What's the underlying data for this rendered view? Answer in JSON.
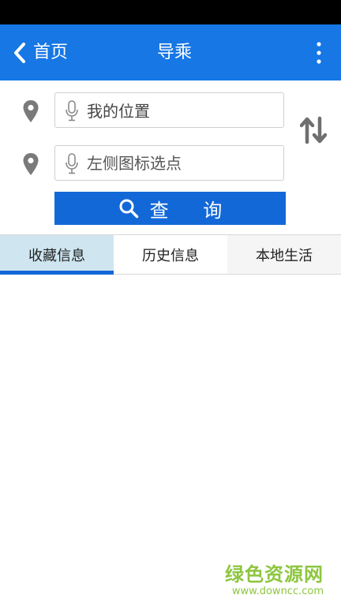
{
  "header": {
    "back_label": "首页",
    "title": "导乘",
    "menu_icon": "more-vertical-icon",
    "bar_color": "#1677e5"
  },
  "form": {
    "origin": {
      "value": "我的位置",
      "icon": "map-pin-icon"
    },
    "destination": {
      "placeholder": "左侧图标选点",
      "icon": "map-pin-icon"
    },
    "swap_icon": "swap-arrows-icon",
    "search_label": "查 询",
    "search_icon": "search-icon",
    "button_color": "#1368d8"
  },
  "tabs": [
    {
      "label": "收藏信息",
      "active": true
    },
    {
      "label": "历史信息",
      "active": false
    },
    {
      "label": "本地生活",
      "active": false
    }
  ],
  "watermark": {
    "text": "绿色资源网",
    "url": "www.downcc.com",
    "color": "#8dc63f"
  }
}
